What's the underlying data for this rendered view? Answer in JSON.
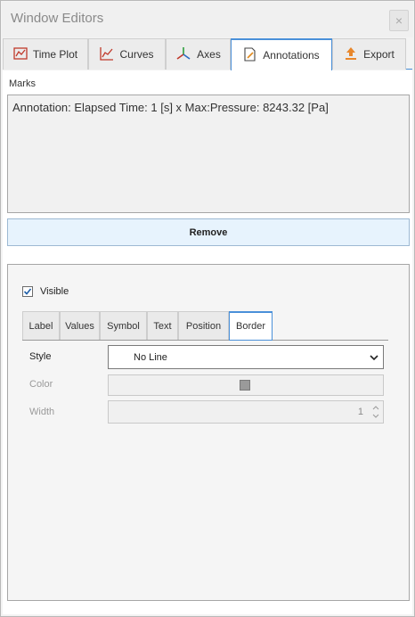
{
  "window": {
    "title": "Window Editors",
    "close_glyph": "×"
  },
  "tabs": [
    {
      "label": "Time Plot",
      "icon": "time-plot-icon"
    },
    {
      "label": "Curves",
      "icon": "curves-icon"
    },
    {
      "label": "Axes",
      "icon": "axes-icon"
    },
    {
      "label": "Annotations",
      "icon": "annotation-icon",
      "active": true
    },
    {
      "label": "Export",
      "icon": "export-icon"
    }
  ],
  "marks": {
    "label": "Marks",
    "items": [
      "Annotation: Elapsed Time: 1 [s] x Max:Pressure: 8243.32 [Pa]"
    ],
    "remove_label": "Remove"
  },
  "editor": {
    "visible_label": "Visible",
    "visible_checked": true,
    "subtabs": [
      "Label",
      "Values",
      "Symbol",
      "Text",
      "Position",
      "Border"
    ],
    "active_subtab": "Border",
    "style_label": "Style",
    "style_value": "No Line",
    "color_label": "Color",
    "color_value": "#9a9a9a",
    "width_label": "Width",
    "width_value": "1"
  },
  "colors": {
    "accent": "#4a90d9",
    "remove_bg": "#e7f3fd"
  }
}
